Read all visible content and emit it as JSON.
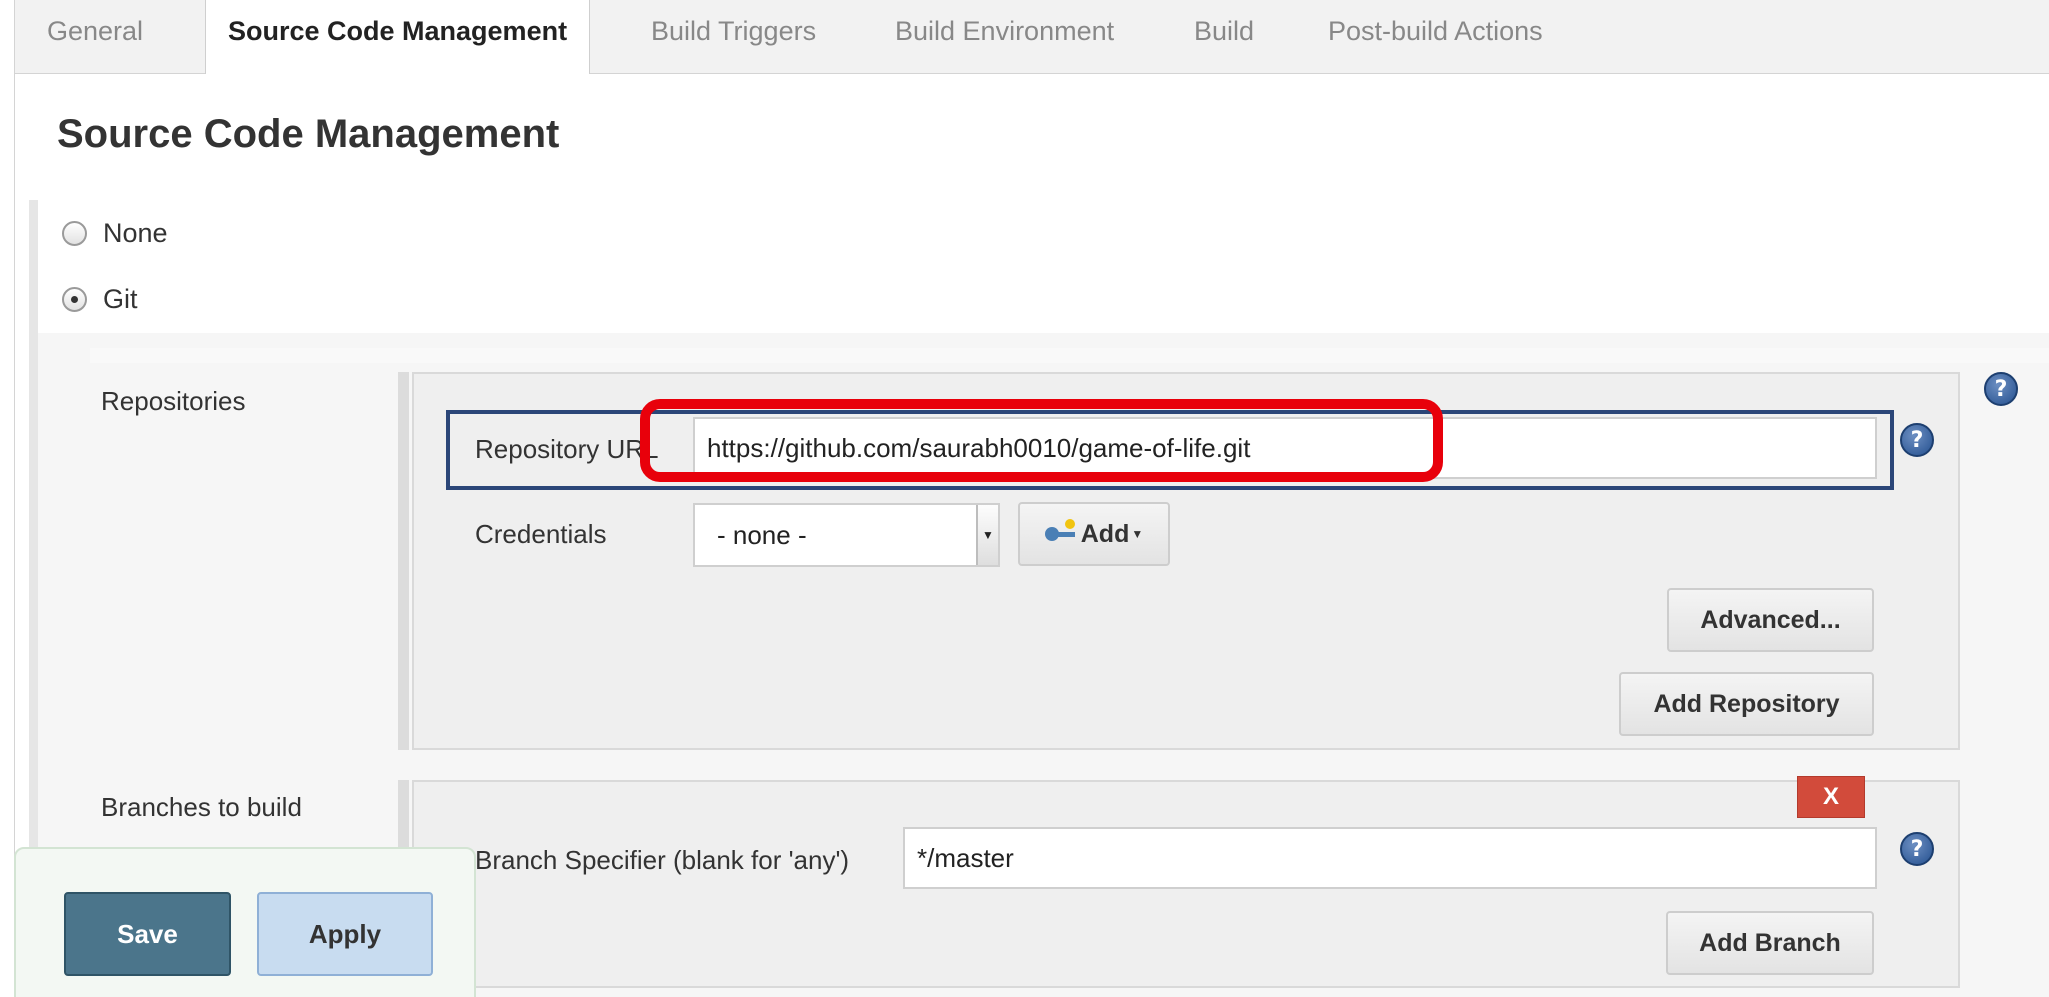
{
  "tabs": [
    {
      "label": "General",
      "active": false
    },
    {
      "label": "Source Code Management",
      "active": true
    },
    {
      "label": "Build Triggers",
      "active": false
    },
    {
      "label": "Build Environment",
      "active": false
    },
    {
      "label": "Build",
      "active": false
    },
    {
      "label": "Post-build Actions",
      "active": false
    }
  ],
  "section": {
    "title": "Source Code Management"
  },
  "scm_options": [
    {
      "label": "None",
      "selected": false
    },
    {
      "label": "Git",
      "selected": true
    }
  ],
  "repositories": {
    "label": "Repositories",
    "repository_url_label": "Repository URL",
    "repository_url_value": "https://github.com/saurabh0010/game-of-life.git",
    "credentials_label": "Credentials",
    "credentials_selected": "- none -",
    "add_credentials_label": "Add",
    "advanced_label": "Advanced...",
    "add_repository_label": "Add Repository"
  },
  "branches": {
    "label": "Branches to build",
    "delete_label": "X",
    "branch_specifier_label": "Branch Specifier (blank for 'any')",
    "branch_specifier_value": "*/master",
    "add_branch_label": "Add Branch"
  },
  "help_icon_glyph": "?",
  "footer": {
    "save_label": "Save",
    "apply_label": "Apply"
  },
  "colors": {
    "annotation_red": "#e8000b",
    "annotation_navy": "#2b4678",
    "save_button": "#4b758b",
    "apply_button": "#c8dcf0",
    "delete_button": "#d24b3b",
    "help_icon": "#24508f"
  }
}
